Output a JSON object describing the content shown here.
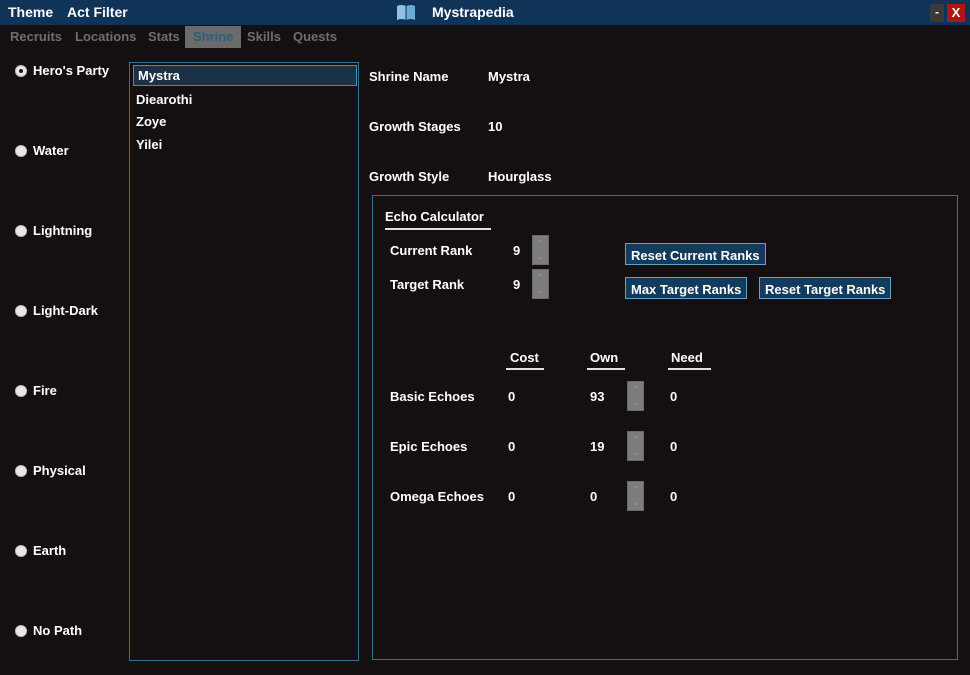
{
  "menu": {
    "theme": "Theme",
    "act_filter": "Act Filter"
  },
  "window": {
    "title": "Mystrapedia",
    "minimize": "-",
    "close": "X"
  },
  "tabs": [
    {
      "label": "Recruits"
    },
    {
      "label": "Locations"
    },
    {
      "label": "Stats"
    },
    {
      "label": "Shrine"
    },
    {
      "label": "Skills"
    },
    {
      "label": "Quests"
    }
  ],
  "active_tab": "Shrine",
  "paths": [
    {
      "label": "Hero's Party",
      "checked": true
    },
    {
      "label": "Water",
      "checked": false
    },
    {
      "label": "Lightning",
      "checked": false
    },
    {
      "label": "Light-Dark",
      "checked": false
    },
    {
      "label": "Fire",
      "checked": false
    },
    {
      "label": "Physical",
      "checked": false
    },
    {
      "label": "Earth",
      "checked": false
    },
    {
      "label": "No Path",
      "checked": false
    }
  ],
  "shrine_list": [
    {
      "name": "Mystra",
      "selected": true
    },
    {
      "name": "Diearothi",
      "selected": false
    },
    {
      "name": "Zoye",
      "selected": false
    },
    {
      "name": "Yilei",
      "selected": false
    }
  ],
  "details": {
    "shrine_name_label": "Shrine Name",
    "shrine_name_value": "Mystra",
    "growth_stages_label": "Growth Stages",
    "growth_stages_value": "10",
    "growth_style_label": "Growth Style",
    "growth_style_value": "Hourglass"
  },
  "echo_calculator": {
    "title": "Echo Calculator",
    "current_rank_label": "Current Rank",
    "current_rank_value": "9",
    "target_rank_label": "Target Rank",
    "target_rank_value": "9",
    "reset_current_label": "Reset Current Ranks",
    "max_target_label": "Max Target Ranks",
    "reset_target_label": "Reset Target Ranks",
    "columns": {
      "cost": "Cost",
      "own": "Own",
      "need": "Need"
    },
    "rows": [
      {
        "label": "Basic Echoes",
        "cost": "0",
        "own": "93",
        "need": "0"
      },
      {
        "label": "Epic Echoes",
        "cost": "0",
        "own": "19",
        "need": "0"
      },
      {
        "label": "Omega Echoes",
        "cost": "0",
        "own": "0",
        "need": "0"
      }
    ]
  },
  "colors": {
    "titlebar": "#0f3458",
    "background": "#141011",
    "border": "#3d6e8a",
    "button": "#123b5e",
    "close": "#b01414"
  }
}
